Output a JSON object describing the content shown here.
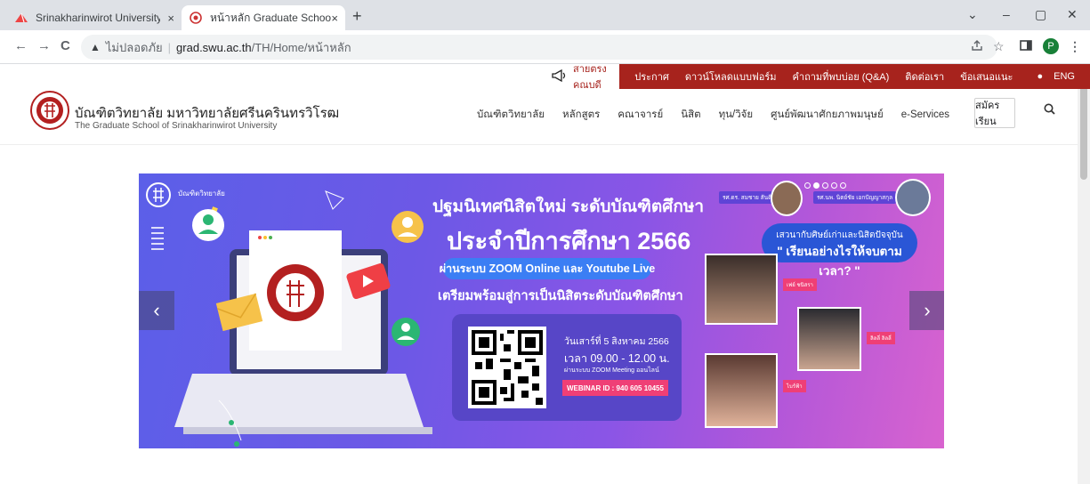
{
  "browser": {
    "tabs": [
      {
        "title": "Srinakharinwirot University : มหาวิ",
        "close": "×"
      },
      {
        "title": "หน้าหลัก Graduate School of Srina",
        "close": "×"
      }
    ],
    "new_tab": "+",
    "window_controls": [
      "⌄",
      "–",
      "▢",
      "✕"
    ],
    "nav": {
      "back": "←",
      "forward": "→",
      "reload": "C"
    },
    "address": {
      "security_icon": "warning-triangle-icon",
      "security_text": "ไม่ปลอดภัย",
      "separator": "|",
      "host": "grad.swu.ac.th",
      "path": "/TH/Home/หน้าหลัก"
    },
    "toolbar_icons": [
      "share-icon",
      "star-icon",
      "sidebar-icon",
      "menu-icon"
    ],
    "profile_initial": "P"
  },
  "site": {
    "colors": {
      "primary": "#a7231d",
      "banner_start": "#5b5fe8",
      "banner_end": "#d863cf"
    },
    "topnav": {
      "call_label": "สายตรงคณบดี",
      "items": [
        "ประกาศ",
        "ดาวน์โหลดแบบฟอร์ม",
        "คำถามที่พบบ่อย (Q&A)",
        "ติดต่อเรา",
        "ข้อเสนอแนะ",
        "ENG"
      ]
    },
    "brand": {
      "name_th": "บัณฑิตวิทยาลัย มหาวิทยาลัยศรีนครินทรวิโรฒ",
      "name_en": "The Graduate School of Srinakharinwirot University"
    },
    "mainnav": [
      "บัณฑิตวิทยาลัย",
      "หลักสูตร",
      "คณาจารย์",
      "นิสิต",
      "ทุน/วิจัย",
      "ศูนย์พัฒนาศักยภาพมนุษย์",
      "e-Services"
    ],
    "apply_label": "สมัครเรียน"
  },
  "banner": {
    "logo_text": "บัณฑิตวิทยาลัย",
    "title_line1": "ปฐมนิเทศนิสิตใหม่ ระดับบัณฑิตศึกษา",
    "title_line2": "ประจำปีการศึกษา 2566",
    "pill": "ผ่านระบบ ZOOM Online และ Youtube Live",
    "subtitle": "เตรียมพร้อมสู่การเป็นนิสิตระดับบัณฑิตศึกษา",
    "date": "วันเสาร์ที่ 5 สิงหาคม 2566",
    "time": "เวลา 09.00 - 12.00 น.",
    "via": "ผ่านระบบ ZOOM Meeting ออนไลน์",
    "webinar": "WEBINAR ID : 940 605 10455",
    "bubble_line1": "เสวนากับศิษย์เก่าและนิสิตปัจจุบัน",
    "bubble_line2": "\" เรียนอย่างไรให้จบตามเวลา? \"",
    "speaker1": "รศ.ดร. สมชาย สันติวัฒนกุล",
    "speaker2": "รศ.นพ. นิตย์ชัย เอกปัญญาสกุล",
    "guest1": "เฟย์ ชนิสรา",
    "guest2": "ลิลลี่ ลิลลี่",
    "guest3": "ไบร์ฟ้า",
    "prev": "‹",
    "next": "›",
    "active_slide_fraction": 0.2
  }
}
